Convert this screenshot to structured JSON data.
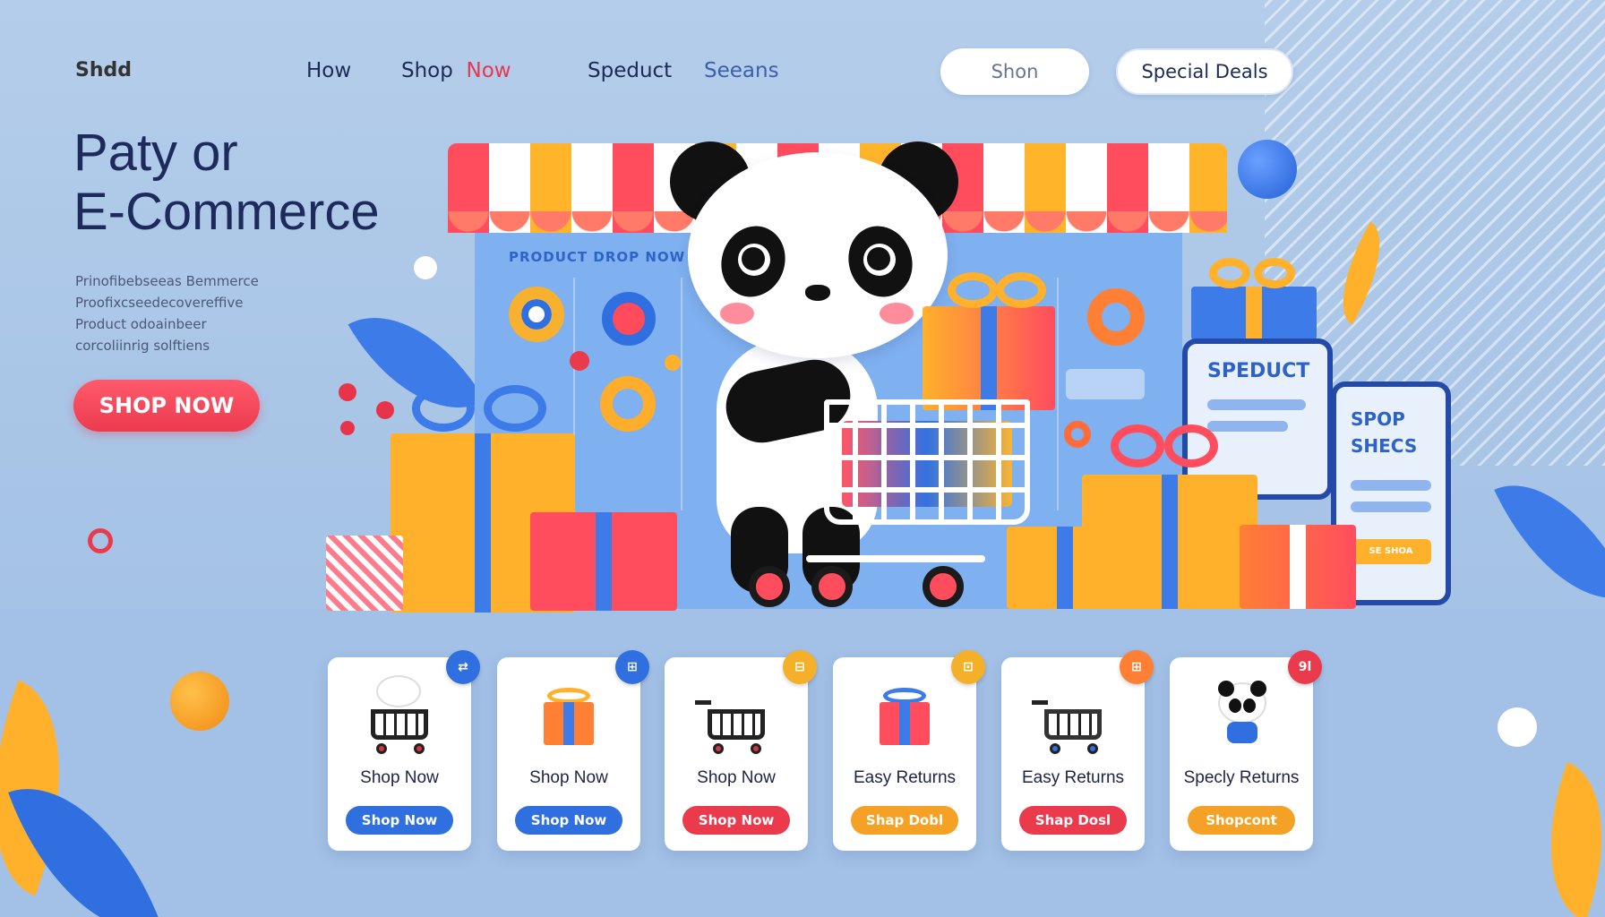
{
  "nav": {
    "logo": "Shdd",
    "links": [
      {
        "label": "How"
      },
      {
        "label_a": "Shop",
        "label_b": "Now"
      },
      {
        "label": "Speduct"
      },
      {
        "label": "Seeans"
      }
    ],
    "search_label": "Shon",
    "deals_label": "Special Deals"
  },
  "hero": {
    "title_line1": "Paty or",
    "title_line2": "E-Commerce",
    "desc": [
      "Prinofibebseeas Bemmerce",
      "Proofixcseedecovereffive",
      "Product odoainbeer",
      "corcoliinrig solftiens"
    ],
    "cta_label": "SHOP NOW"
  },
  "scene": {
    "storefront_text": "PRODUCT DROP NOW",
    "phone1_text": "SPEDUCT",
    "phone2_line1": "SPOP",
    "phone2_line2": "SHECS",
    "phone2_button": "SE SHOA"
  },
  "cards": [
    {
      "title": "Shop Now",
      "button": "Shop Now",
      "badge": "⇄",
      "button_color": "#2f6fe0",
      "badge_color": "#2f6fe0",
      "icon": "cart-panda-icon"
    },
    {
      "title": "Shop Now",
      "button": "Shop Now",
      "badge": "⊞",
      "button_color": "#2f6fe0",
      "badge_color": "#2f6fe0",
      "icon": "gift-icon"
    },
    {
      "title": "Shop Now",
      "button": "Shop Now",
      "badge": "⊟",
      "button_color": "#ea3a4c",
      "badge_color": "#f5b02a",
      "icon": "cart-icon"
    },
    {
      "title": "Easy Returns",
      "button": "Shap Dobl",
      "badge": "⊡",
      "button_color": "#f4a126",
      "badge_color": "#f5b02a",
      "icon": "gift-icon"
    },
    {
      "title": "Easy Returns",
      "button": "Shap Dosl",
      "badge": "⊞",
      "button_color": "#ea3a4c",
      "badge_color": "#ff7f35",
      "icon": "cart-icon"
    },
    {
      "title": "Specly Returns",
      "button": "Shopcont",
      "badge": "9l",
      "button_color": "#f4a126",
      "badge_color": "#ea3a4c",
      "icon": "panda-icon"
    }
  ],
  "colors": {
    "accent_red": "#ec3a4f",
    "accent_blue": "#2f6fe0",
    "accent_yellow": "#ffb429",
    "navy_text": "#1f2a5c",
    "background": "#a9c7e8"
  }
}
